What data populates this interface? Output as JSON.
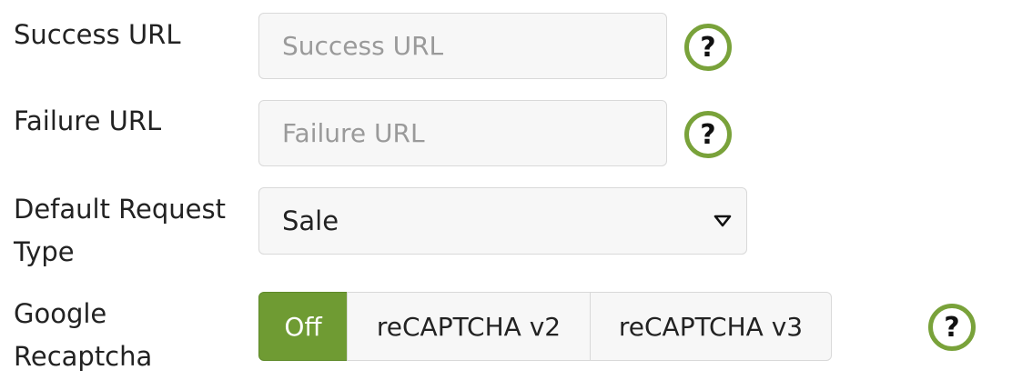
{
  "fields": {
    "success_url": {
      "label": "Success URL",
      "placeholder": "Success URL",
      "value": ""
    },
    "failure_url": {
      "label": "Failure URL",
      "placeholder": "Failure URL",
      "value": ""
    },
    "default_request_type": {
      "label_line1": "Default Request",
      "label_line2": "Type",
      "selected": "Sale"
    },
    "google_recaptcha": {
      "label_line1": "Google",
      "label_line2": "Recaptcha",
      "options": [
        "Off",
        "reCAPTCHA v2",
        "reCAPTCHA v3"
      ],
      "selected": "Off"
    }
  },
  "help_icon_glyph": "?",
  "colors": {
    "accent": "#79a23a",
    "active_segment": "#6f9b33",
    "input_background": "#f7f7f7",
    "border": "#d9d9d9"
  },
  "icons": {
    "help": "question-circle-icon",
    "dropdown": "caret-down-icon"
  }
}
